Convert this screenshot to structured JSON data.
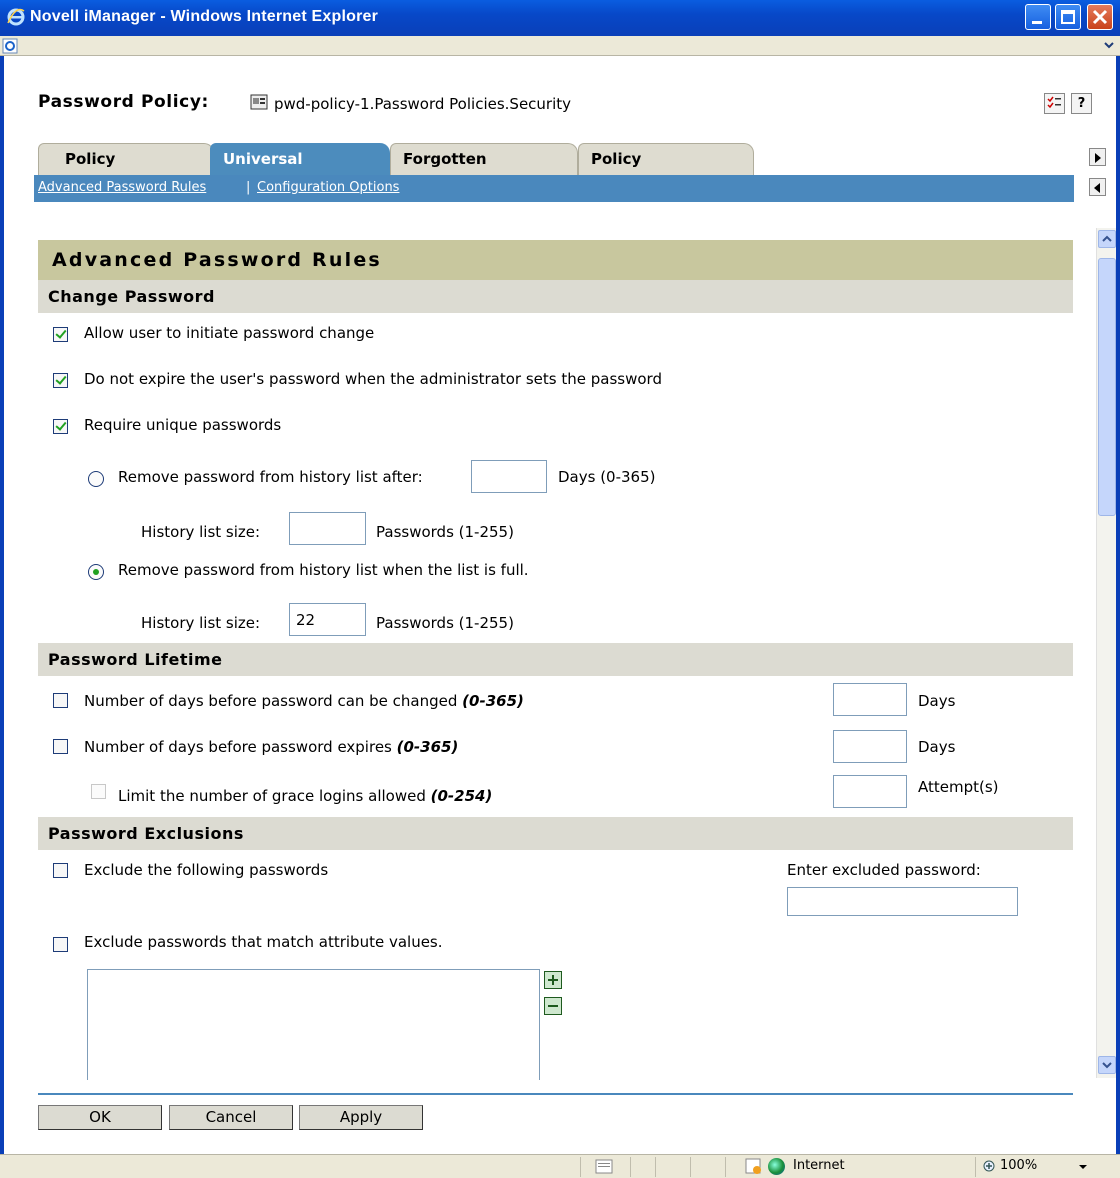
{
  "window": {
    "title": "Novell iManager - Windows Internet Explorer"
  },
  "header": {
    "label": "Password Policy:",
    "policy_name": "pwd-policy-1.Password Policies.Security",
    "help_label": "?"
  },
  "tabs": [
    {
      "label": "Policy Summary",
      "active": false
    },
    {
      "label": "Universal Password",
      "active": true
    },
    {
      "label": "Forgotten Password",
      "active": false
    },
    {
      "label": "Policy Assignment",
      "active": false
    }
  ],
  "subnav": {
    "link1": "Advanced Password Rules",
    "separator": "|",
    "link2": "Configuration Options"
  },
  "section": {
    "title": "Advanced Password Rules"
  },
  "change_password": {
    "header": "Change Password",
    "allow_change": {
      "label": "Allow user to initiate password change",
      "checked": true
    },
    "no_expire": {
      "label": "Do not expire the user's password when the administrator sets the password",
      "checked": true
    },
    "require_unique": {
      "label": "Require unique passwords",
      "checked": true
    },
    "history_days": {
      "label": "Remove password from history list after:",
      "value": "",
      "unit": "Days (0-365)",
      "selected": false
    },
    "history_size_1": {
      "label": "History list size:",
      "value": "",
      "unit": "Passwords (1-255)"
    },
    "history_full": {
      "label": "Remove password from history list when the list is full.",
      "selected": true
    },
    "history_size_2": {
      "label": "History list size:",
      "value": "22",
      "unit": "Passwords (1-255)"
    }
  },
  "lifetime": {
    "header": "Password Lifetime",
    "days_before_change": {
      "label": "Number of days before password can be changed ",
      "range": "(0-365)",
      "unit": "Days",
      "checked": false
    },
    "days_before_expire": {
      "label": "Number of days before password expires ",
      "range": "(0-365)",
      "unit": "Days",
      "checked": false
    },
    "grace_logins": {
      "label": "Limit the number of grace logins allowed ",
      "range": "(0-254)",
      "unit": "Attempt(s)",
      "checked": false
    }
  },
  "exclusions": {
    "header": "Password Exclusions",
    "exclude_following": {
      "label": "Exclude the following passwords",
      "checked": false
    },
    "excluded_input_label": "Enter excluded password:",
    "exclude_attr": {
      "label": "Exclude passwords that match attribute values.",
      "checked": false
    }
  },
  "footer": {
    "ok": "OK",
    "cancel": "Cancel",
    "apply": "Apply"
  },
  "statusbar": {
    "zone": "Internet",
    "zoom": "100%"
  },
  "colors": {
    "titlebar": "#0748c8",
    "tab_active": "#4c8cbd",
    "section_title_bg": "#c8c79e",
    "subheader_bg": "#dcdbd2",
    "check_mark": "#21a121"
  }
}
